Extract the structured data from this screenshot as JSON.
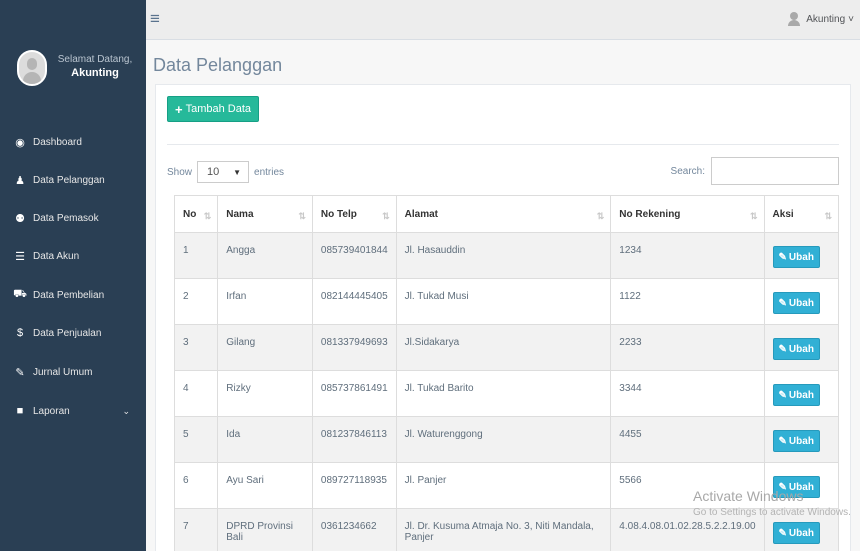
{
  "sidebar": {
    "welcome": "Selamat Datang,",
    "username": "Akunting",
    "items": [
      {
        "label": "Dashboard",
        "icon": "dashboard-icon",
        "glyph": "◉"
      },
      {
        "label": "Data Pelanggan",
        "icon": "user-icon",
        "glyph": "♟"
      },
      {
        "label": "Data Pemasok",
        "icon": "users-icon",
        "glyph": "⚉"
      },
      {
        "label": "Data Akun",
        "icon": "list-icon",
        "glyph": "☰"
      },
      {
        "label": "Data Pembelian",
        "icon": "truck-icon",
        "glyph": "⛟"
      },
      {
        "label": "Data Penjualan",
        "icon": "dollar-icon",
        "glyph": "$"
      },
      {
        "label": "Jurnal Umum",
        "icon": "edit-icon",
        "glyph": "✎"
      },
      {
        "label": "Laporan",
        "icon": "file-icon",
        "glyph": "■"
      }
    ],
    "laporan_chevron": "⌄"
  },
  "topbar": {
    "menu_icon": "≡",
    "user": "Akunting",
    "caret": "˅"
  },
  "page": {
    "title": "Data Pelanggan",
    "add_button": "Tambah Data",
    "add_icon": "+"
  },
  "table_controls": {
    "show": "Show",
    "length": "10",
    "entries": "entries",
    "search": "Search:"
  },
  "table": {
    "headers": [
      "No",
      "Nama",
      "No Telp",
      "Alamat",
      "No Rekening",
      "Aksi"
    ],
    "sort_icons": [
      "⇅",
      "⇅",
      "⇅",
      "⇅",
      "⇅",
      "⇅"
    ],
    "action_label": "Ubah",
    "action_icon": "✎",
    "rows": [
      {
        "no": "1",
        "nama": "Angga",
        "telp": "085739401844",
        "alamat": "Jl. Hasauddin",
        "rekening": "1234"
      },
      {
        "no": "2",
        "nama": "Irfan",
        "telp": "082144445405",
        "alamat": "Jl. Tukad Musi",
        "rekening": "1122"
      },
      {
        "no": "3",
        "nama": "Gilang",
        "telp": "081337949693",
        "alamat": "Jl.Sidakarya",
        "rekening": "2233"
      },
      {
        "no": "4",
        "nama": "Rizky",
        "telp": "085737861491",
        "alamat": "Jl. Tukad Barito",
        "rekening": "3344"
      },
      {
        "no": "5",
        "nama": "Ida",
        "telp": "081237846113",
        "alamat": "Jl. Waturenggong",
        "rekening": "4455"
      },
      {
        "no": "6",
        "nama": "Ayu Sari",
        "telp": "089727118935",
        "alamat": "Jl. Panjer",
        "rekening": "5566"
      },
      {
        "no": "7",
        "nama": "DPRD Provinsi Bali",
        "telp": "0361234662",
        "alamat": "Jl. Dr. Kusuma Atmaja No. 3, Niti Mandala, Panjer",
        "rekening": "4.08.4.08.01.02.28.5.2.2.19.00"
      }
    ]
  },
  "watermark": {
    "line1": "Activate Windows",
    "line2": "Go to Settings to activate Windows."
  }
}
